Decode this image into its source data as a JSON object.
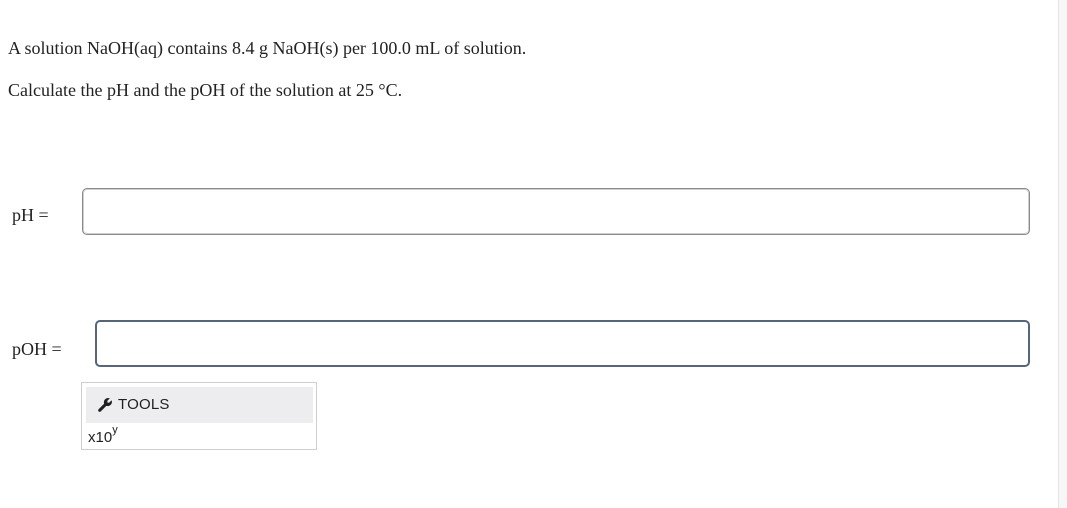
{
  "question": {
    "line1": "A solution NaOH(aq) contains 8.4 g NaOH(s) per 100.0 mL of solution.",
    "line2": "Calculate the pH and the pOH of the solution at 25 °C."
  },
  "answers": {
    "ph": {
      "label": "pH =",
      "value": ""
    },
    "poh": {
      "label": "pOH =",
      "value": ""
    }
  },
  "tools": {
    "label": "TOOLS",
    "icon": "wrench-icon",
    "sci_notation": {
      "base": "x10",
      "exponent": "y"
    }
  }
}
